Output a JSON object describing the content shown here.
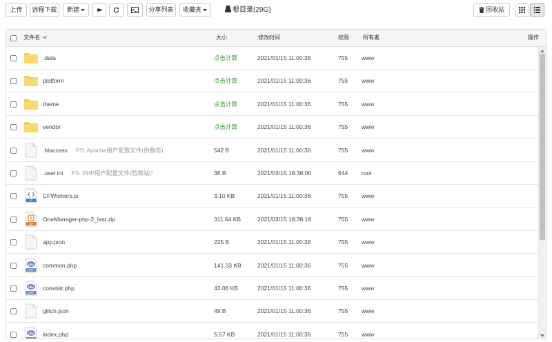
{
  "toolbar": {
    "upload_label": "上传",
    "remote_download_label": "远程下载",
    "new_label": "新建",
    "share_list_label": "分享列表",
    "favorites_label": "收藏夹",
    "root_path_label": "根目录(29G)",
    "recycle_bin_label": "回收站"
  },
  "table": {
    "headers": {
      "name": "文件名",
      "size": "大小",
      "modified": "修改时间",
      "permission": "权限",
      "owner": "所有者",
      "actions": "操作"
    },
    "rows": [
      {
        "name": ".data",
        "icon": "folder-icon",
        "size": "点击计算",
        "modified": "2021/01/15 11:00:36",
        "perm": "755",
        "owner": "www",
        "note": ""
      },
      {
        "name": "platform",
        "icon": "folder-icon",
        "size": "点击计算",
        "modified": "2021/01/15 11:00:36",
        "perm": "755",
        "owner": "www",
        "note": ""
      },
      {
        "name": "theme",
        "icon": "folder-icon",
        "size": "点击计算",
        "modified": "2021/01/15 11:00:36",
        "perm": "755",
        "owner": "www",
        "note": ""
      },
      {
        "name": "vendor",
        "icon": "folder-icon",
        "size": "点击计算",
        "modified": "2021/01/15 11:00:36",
        "perm": "755",
        "owner": "www",
        "note": ""
      },
      {
        "name": ".htaccess",
        "icon": "file-icon",
        "size": "542 B",
        "modified": "2021/01/15 11:00:36",
        "perm": "755",
        "owner": "www",
        "note": "PS: Apache用户配置文件(伪静态)"
      },
      {
        "name": ".user.ini",
        "icon": "file-icon",
        "size": "38 B",
        "modified": "2021/03/15 18:38:06",
        "perm": "644",
        "owner": "root",
        "note": "PS: PHP用户配置文件(防跨站)!"
      },
      {
        "name": "CFWorkers.js",
        "icon": "js-file-icon",
        "size": "3.10 KB",
        "modified": "2021/01/15 11:00:36",
        "perm": "755",
        "owner": "www",
        "note": ""
      },
      {
        "name": "OneManager-php-2_last.zip",
        "icon": "zip-file-icon",
        "size": "311.64 KB",
        "modified": "2021/03/15 18:38:18",
        "perm": "755",
        "owner": "www",
        "note": ""
      },
      {
        "name": "app.json",
        "icon": "file-icon",
        "size": "225 B",
        "modified": "2021/01/15 11:00:36",
        "perm": "755",
        "owner": "www",
        "note": ""
      },
      {
        "name": "common.php",
        "icon": "php-file-icon",
        "size": "141.33 KB",
        "modified": "2021/01/15 11:00:36",
        "perm": "755",
        "owner": "www",
        "note": ""
      },
      {
        "name": "conststr.php",
        "icon": "php-file-icon",
        "size": "43.06 KB",
        "modified": "2021/01/15 11:00:36",
        "perm": "755",
        "owner": "www",
        "note": ""
      },
      {
        "name": "glitch.json",
        "icon": "file-icon",
        "size": "49 B",
        "modified": "2021/01/15 11:00:36",
        "perm": "755",
        "owner": "www",
        "note": ""
      },
      {
        "name": "index.php",
        "icon": "php-file-icon",
        "size": "5.57 KB",
        "modified": "2021/01/15 11:00:36",
        "perm": "755",
        "owner": "www",
        "note": ""
      }
    ]
  }
}
